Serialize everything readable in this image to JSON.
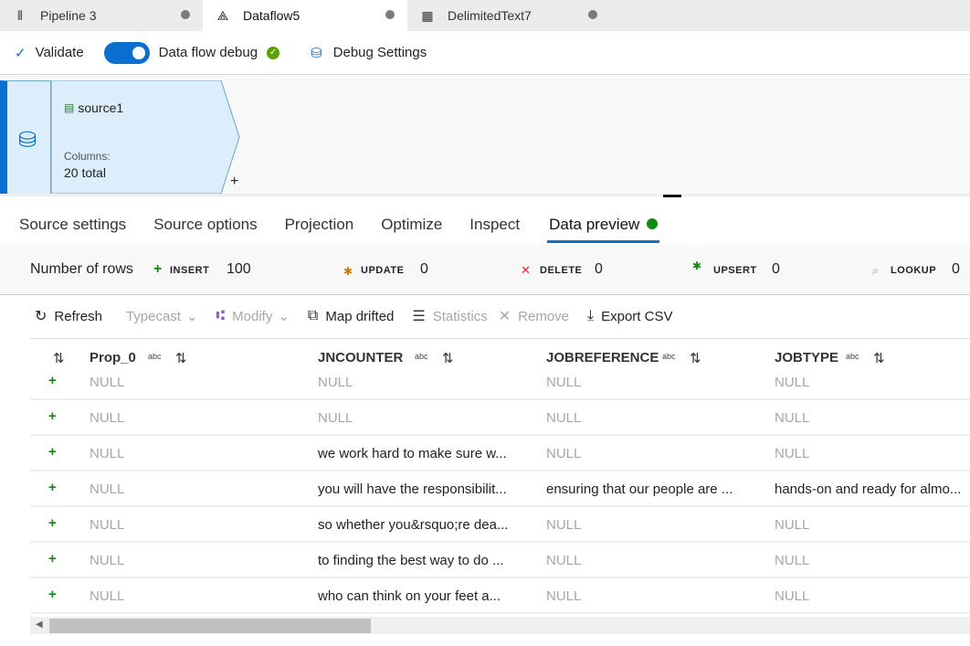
{
  "tabs": [
    {
      "label": "Pipeline 3",
      "icon": "pipeline-icon"
    },
    {
      "label": "Dataflow5",
      "icon": "dataflow-icon",
      "active": true
    },
    {
      "label": "DelimitedText7",
      "icon": "table-icon"
    }
  ],
  "toolbar": {
    "validate": "Validate",
    "debug": "Data flow debug",
    "debug_on": true,
    "debug_settings": "Debug Settings"
  },
  "node": {
    "name": "source1",
    "columns_label": "Columns:",
    "columns_value": "20 total"
  },
  "panel_tabs": [
    "Source settings",
    "Source options",
    "Projection",
    "Optimize",
    "Inspect",
    "Data preview"
  ],
  "rows_bar": {
    "label": "Number of rows",
    "insert": "INSERT",
    "insert_n": "100",
    "update": "UPDATE",
    "update_n": "0",
    "delete": "DELETE",
    "delete_n": "0",
    "upsert": "UPSERT",
    "upsert_n": "0",
    "lookup": "LOOKUP",
    "lookup_n": "0"
  },
  "data_toolbar": {
    "refresh": "Refresh",
    "typecast": "Typecast",
    "modify": "Modify",
    "map_drifted": "Map drifted",
    "statistics": "Statistics",
    "remove": "Remove",
    "export": "Export CSV"
  },
  "columns": [
    {
      "name": "Prop_0",
      "type": "abc"
    },
    {
      "name": "JNCOUNTER",
      "type": "abc"
    },
    {
      "name": "JOBREFERENCE",
      "type": "abc"
    },
    {
      "name": "JOBTYPE",
      "type": "abc"
    }
  ],
  "rows": [
    [
      "NULL",
      "NULL",
      "NULL",
      "NULL"
    ],
    [
      "NULL",
      "NULL",
      "NULL",
      "NULL"
    ],
    [
      "NULL",
      "we work hard to make sure w...",
      "NULL",
      "NULL"
    ],
    [
      "NULL",
      "you will have the responsibilit...",
      "ensuring that our people are ...",
      "hands-on and ready for almo..."
    ],
    [
      "NULL",
      "so whether you&rsquo;re dea...",
      "NULL",
      "NULL"
    ],
    [
      "NULL",
      "to finding the best way to do ...",
      "NULL",
      "NULL"
    ],
    [
      "NULL",
      "who can think on your feet a...",
      "NULL",
      "NULL"
    ]
  ],
  "colors": {
    "accent": "#0a6fd1",
    "insert": "#118a11",
    "node_fill": "#dceefb"
  }
}
